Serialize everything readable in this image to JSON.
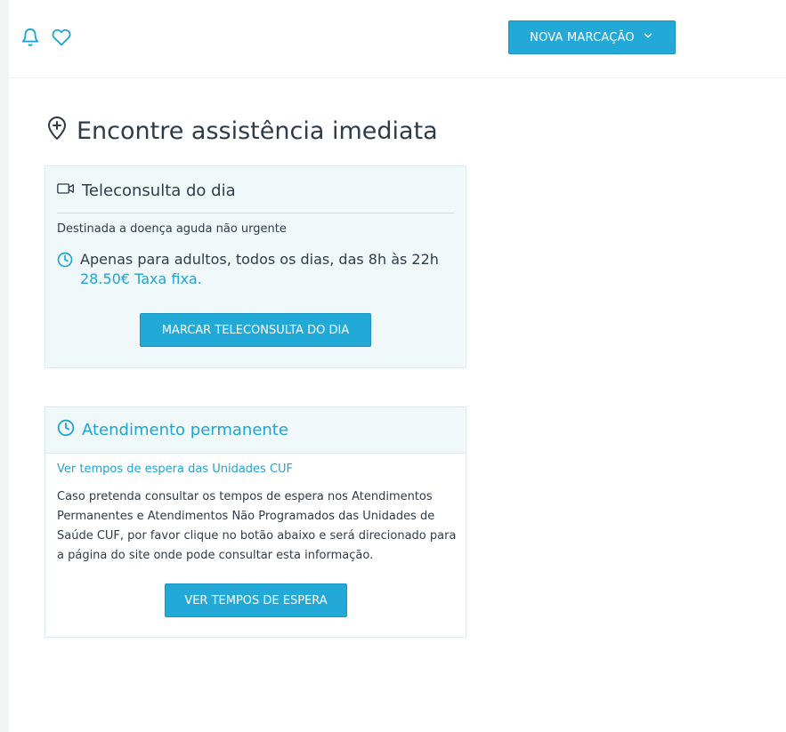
{
  "header": {
    "nova_marcacao_label": "NOVA MARCAÇÃO"
  },
  "section": {
    "title": "Encontre assistência imediata"
  },
  "teleconsulta": {
    "title": "Teleconsulta do dia",
    "subtitle": "Destinada a doença aguda não urgente",
    "schedule": "Apenas para adultos, todos os dias, das 8h às 22h",
    "price": "28.50€ Taxa fixa.",
    "button_label": "MARCAR TELECONSULTA DO DIA"
  },
  "atendimento": {
    "title": "Atendimento permanente",
    "link_label": "Ver tempos de espera das Unidades CUF",
    "description": "Caso pretenda consultar os tempos de espera nos Atendimentos Permanentes e Atendimentos Não Programados das Unidades de Saúde CUF, por favor clique no botão abaixo e será direcionado para a página do site onde pode consultar esta informação.",
    "button_label": "VER TEMPOS DE ESPERA"
  },
  "icons": {
    "notifications": "bell-icon",
    "favorites": "heart-icon",
    "dropdown": "chevron-down-icon",
    "location": "map-pin-plus-icon",
    "video": "video-camera-icon",
    "clock": "clock-icon"
  },
  "colors": {
    "accent": "#22a9d8",
    "accent_text": "#1ea4d1",
    "card_background": "#f1f8fa",
    "text": "#2e3c4a"
  }
}
